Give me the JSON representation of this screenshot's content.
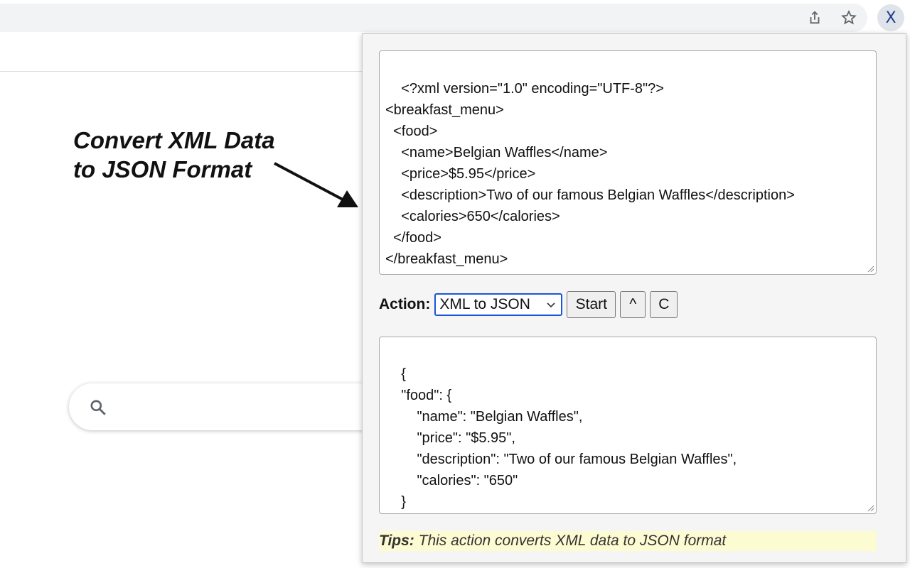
{
  "browser": {
    "share_icon": "share-icon",
    "bookmark_icon": "star-icon",
    "extension_badge": "X"
  },
  "annotation": {
    "line1": "Convert XML Data",
    "line2": "to JSON Format"
  },
  "search": {
    "icon": "search-icon",
    "value": ""
  },
  "popup": {
    "input_text": "<?xml version=\"1.0\" encoding=\"UTF-8\"?>\n<breakfast_menu>\n  <food>\n    <name>Belgian Waffles</name>\n    <price>$5.95</price>\n    <description>Two of our famous Belgian Waffles</description>\n    <calories>650</calories>\n  </food>\n</breakfast_menu>",
    "action_label": "Action:",
    "action_selected": "XML to JSON",
    "start_label": "Start",
    "up_label": "^",
    "clear_label": "C",
    "output_text": "{\n    \"food\": {\n        \"name\": \"Belgian Waffles\",\n        \"price\": \"$5.95\",\n        \"description\": \"Two of our famous Belgian Waffles\",\n        \"calories\": \"650\"\n    }\n}",
    "tips_label": "Tips:",
    "tips_text": " This action converts XML data to JSON format"
  },
  "colors": {
    "select_border": "#1a56d6",
    "tips_bg": "#fdfbd2",
    "extension_icon_bg": "#dfe3ea"
  }
}
